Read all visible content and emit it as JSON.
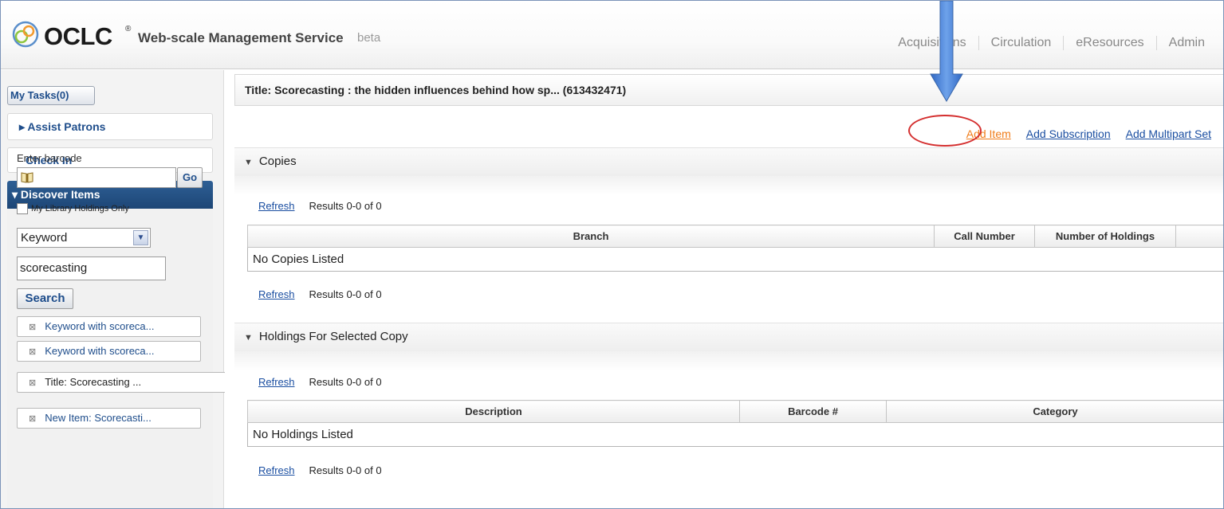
{
  "header": {
    "brand": "OCLC",
    "registered": "®",
    "app_name": "Web-scale Management Service",
    "beta": "beta",
    "tabs": [
      "Acquisitions",
      "Circulation",
      "eResources",
      "Admin"
    ]
  },
  "sidebar": {
    "my_tasks": "My Tasks(0)",
    "assist_patrons": "▸ Assist Patrons",
    "check_in": "Check In",
    "discover_items": "▾ Discover Items",
    "barcode_label": "Enter barcode",
    "go": "Go",
    "my_library_holdings": "My Library Holdings Only",
    "search_type": "Keyword",
    "search_value": "scorecasting",
    "search_button": "Search",
    "crumbs": [
      "Keyword with scoreca...",
      "Keyword with scoreca...",
      "Title: Scorecasting ...",
      "New Item: Scorecasti..."
    ]
  },
  "main": {
    "title": "Title: Scorecasting : the hidden influences behind how sp... (613432471)",
    "actions": {
      "add_item": "Add Item",
      "add_subscription": "Add Subscription",
      "add_multipart_set": "Add Multipart Set"
    },
    "copies": {
      "heading": "Copies",
      "refresh": "Refresh",
      "results": "Results 0-0 of 0",
      "columns": [
        "Branch",
        "Call Number",
        "Number of Holdings"
      ],
      "empty": "No Copies Listed"
    },
    "holdings": {
      "heading": "Holdings For Selected Copy",
      "refresh": "Refresh",
      "results": "Results 0-0 of 0",
      "columns": [
        "Description",
        "Barcode #",
        "Category"
      ],
      "empty": "No Holdings Listed"
    }
  },
  "colors": {
    "link": "#1a4ea1",
    "highlight_link": "#f07d1a",
    "annotation_circle": "#d42f2f",
    "annotation_arrow": "#3a7bd5",
    "sidebar_accent": "#1d4676"
  },
  "icons": [
    "oclc-logo-icon",
    "book-icon",
    "chevron-down-icon",
    "close-icon",
    "down-arrow-annotation-icon"
  ]
}
